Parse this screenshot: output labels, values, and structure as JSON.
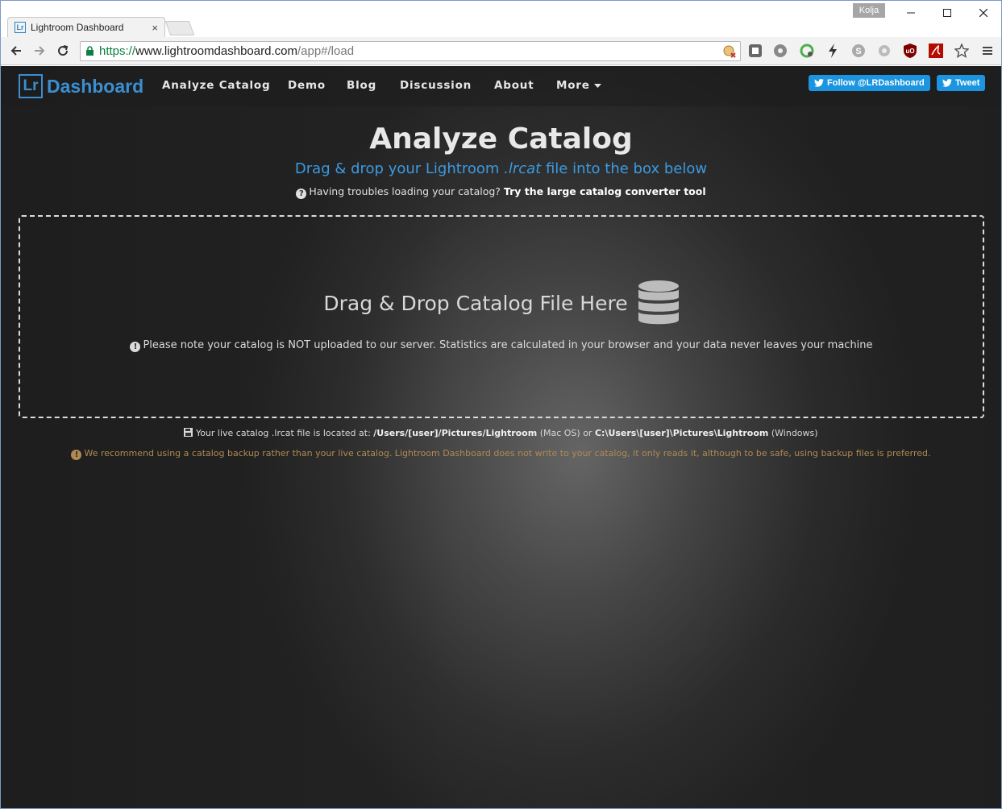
{
  "browser": {
    "tab_title": "Lightroom Dashboard",
    "tab_favicon_text": "Lr",
    "tab_close": "×",
    "profile_name": "Kolja",
    "url_scheme": "https://",
    "url_host": "www.lightroomdashboard.com",
    "url_path": "/app#/load",
    "icons": [
      "back-icon",
      "forward-icon",
      "reload-icon",
      "lock-icon",
      "star-icon",
      "menu-icon"
    ]
  },
  "navbar": {
    "brand_lr": "Lr",
    "brand_name": "Dashboard",
    "links": {
      "analyze": "Analyze Catalog",
      "demo": "Demo",
      "blog": "Blog",
      "discussion": "Discussion",
      "about": "About",
      "more": "More"
    },
    "follow_label": "Follow @LRDashboard",
    "tweet_label": "Tweet",
    "twitter_color": "#1b95e0",
    "brand_color": "#3b8fd1"
  },
  "main": {
    "title": "Analyze Catalog",
    "subtitle_before": "Drag & drop your Lightroom ",
    "subtitle_ext": ".lrcat",
    "subtitle_after": " file into the box below",
    "help_text": "Having troubles loading your catalog?",
    "help_link": "Try the large catalog converter tool",
    "dropzone": {
      "title": "Drag & Drop Catalog File Here",
      "icon": "database-icon",
      "note": "Please note your catalog is NOT uploaded to our server. Statistics are calculated in your browser and your data never leaves your machine"
    },
    "location": {
      "prefix": "Your live catalog .lrcat file is located at:",
      "mac_path": "/Users/[user]/Pictures/Lightroom",
      "mac_label": "(Mac OS) or",
      "win_path": "C:\\Users\\[user]\\Pictures\\Lightroom",
      "win_label": "(Windows)"
    },
    "recommendation": "We recommend using a catalog backup rather than your live catalog. Lightroom Dashboard does not write to your catalog, it only reads it, although to be safe, using backup files is preferred.",
    "warning_color": "#b08a52"
  }
}
